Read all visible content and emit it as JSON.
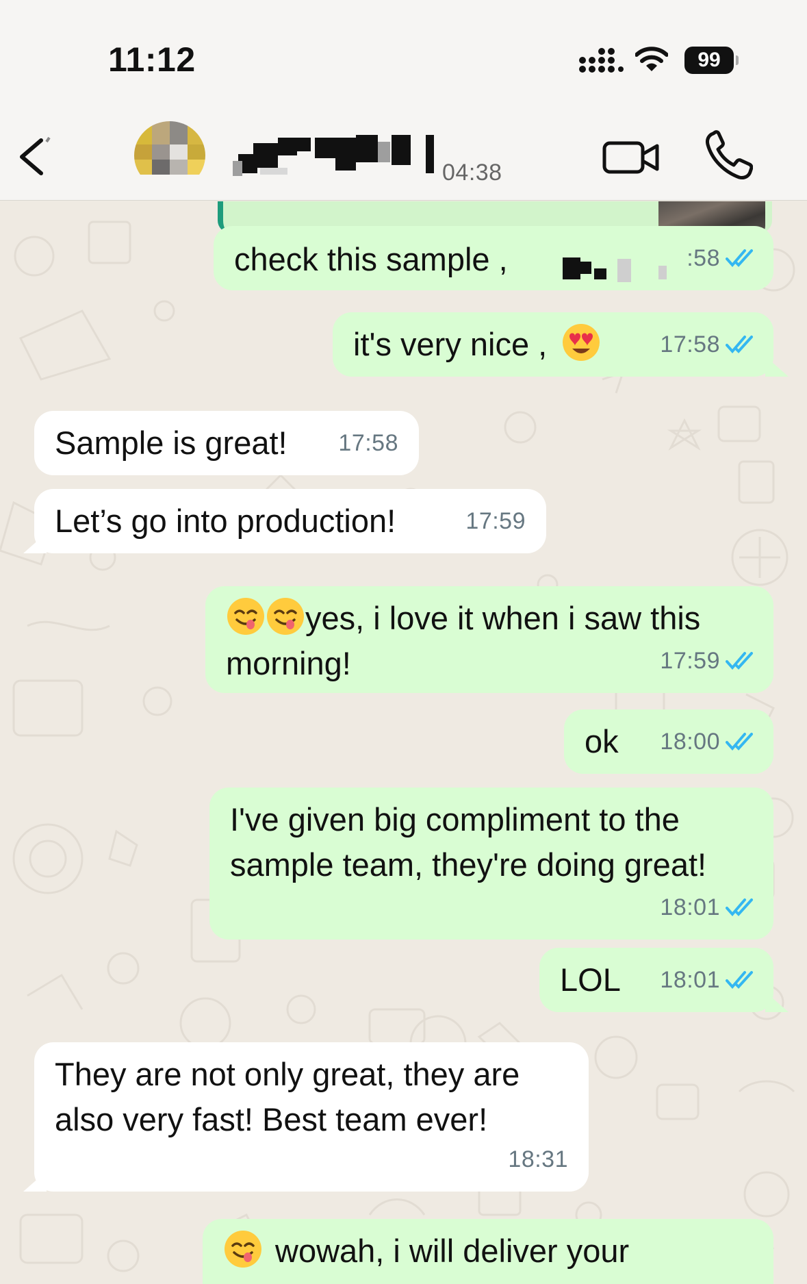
{
  "status_bar": {
    "time": "11:12",
    "battery": "99"
  },
  "header": {
    "last_seen": "04:38"
  },
  "colors": {
    "outgoing_bubble": "#d9fdd3",
    "incoming_bubble": "#ffffff",
    "ticks": "#34b7f1",
    "chat_bg": "#efeae2"
  },
  "messages": [
    {
      "direction": "out",
      "text": "check this sample ,",
      "time": ":58",
      "status": "read"
    },
    {
      "direction": "out",
      "text": "it's very nice ,",
      "emoji": "heart-eyes",
      "time": "17:58",
      "status": "read"
    },
    {
      "direction": "in",
      "text": "Sample is great!",
      "time": "17:58"
    },
    {
      "direction": "in",
      "text": "Let’s go into production!",
      "time": "17:59"
    },
    {
      "direction": "out",
      "emoji": "yum yum",
      "text": "yes, i love it when i saw this morning!",
      "line1": "yes, i love it when i saw this",
      "line2": "morning!",
      "time": "17:59",
      "status": "read"
    },
    {
      "direction": "out",
      "text": "ok",
      "time": "18:00",
      "status": "read"
    },
    {
      "direction": "out",
      "text": "I've given big compliment to the sample team, they're doing great!",
      "line1": "I've given big compliment to the",
      "line2": "sample team, they're doing great!",
      "time": "18:01",
      "status": "read"
    },
    {
      "direction": "out",
      "text": "LOL",
      "time": "18:01",
      "status": "read"
    },
    {
      "direction": "in",
      "text": "They are not only great, they are also very fast! Best team ever!",
      "line1": "They are not only great, they are",
      "line2": "also very fast! Best team ever!",
      "time": "18:31"
    },
    {
      "direction": "out",
      "emoji": "yum",
      "text": "wowah, i will deliver your",
      "time": ""
    }
  ]
}
